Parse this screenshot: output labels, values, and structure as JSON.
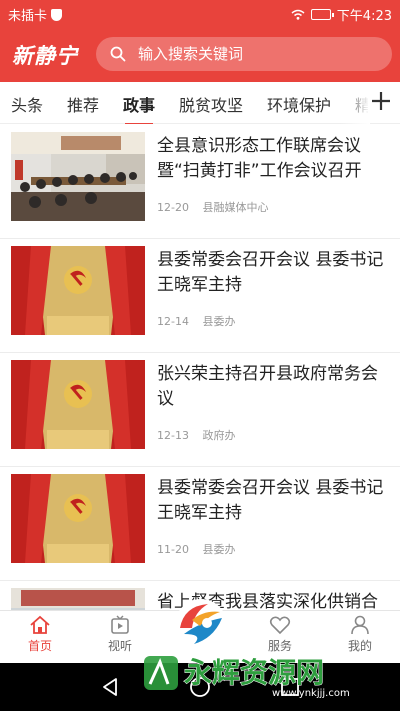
{
  "status": {
    "carrier": "未插卡",
    "time": "下午4:23"
  },
  "app": {
    "logo_text": "新静宁",
    "search_placeholder": "输入搜索关键词",
    "accent": "#e8433c"
  },
  "tabs": [
    {
      "label": "头条",
      "active": false
    },
    {
      "label": "推荐",
      "active": false
    },
    {
      "label": "政事",
      "active": true
    },
    {
      "label": "脱贫攻坚",
      "active": false
    },
    {
      "label": "环境保护",
      "active": false
    },
    {
      "label": "精",
      "active": false
    }
  ],
  "articles": [
    {
      "title": "全县意识形态工作联席会议暨“扫黄打非”工作会议召开",
      "date": "12-20",
      "source": "县融媒体中心",
      "thumb": "meeting-room-photo"
    },
    {
      "title": "县委常委会召开会议 县委书记王晓军主持",
      "date": "12-14",
      "source": "县委办",
      "thumb": "party-flag-photo"
    },
    {
      "title": "张兴荣主持召开县政府常务会议",
      "date": "12-13",
      "source": "政府办",
      "thumb": "party-flag-photo"
    },
    {
      "title": "县委常委会召开会议 县委书记王晓军主持",
      "date": "11-20",
      "source": "县委办",
      "thumb": "party-flag-photo"
    },
    {
      "title": "省上督查我县落实深化供销合",
      "date": "",
      "source": "",
      "thumb": "office-photo"
    }
  ],
  "bottom_nav": [
    {
      "label": "首页",
      "icon": "home-icon",
      "active": true
    },
    {
      "label": "视听",
      "icon": "video-icon",
      "active": false
    },
    {
      "label": "服务",
      "icon": "heart-hands-icon",
      "active": false
    },
    {
      "label": "我的",
      "icon": "person-icon",
      "active": false
    }
  ],
  "watermark": {
    "text": "永辉资源网",
    "url": "www.ynkjjj.com"
  }
}
